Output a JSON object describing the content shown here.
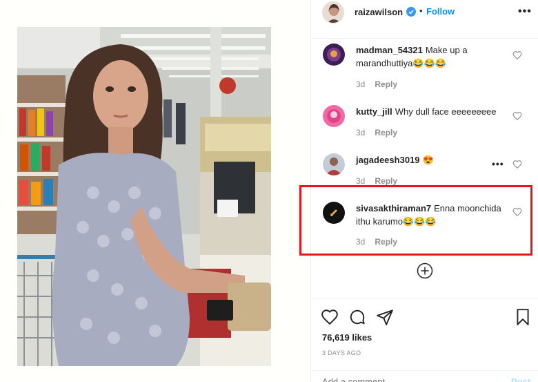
{
  "post": {
    "username": "raizawilson",
    "follow_label": "Follow",
    "dot": "•",
    "more_label": "•••"
  },
  "comments": [
    {
      "user": "madman_54321",
      "text": "Make up a marandhuttiya😂😂😂",
      "time": "3d",
      "reply": "Reply",
      "avatar_color": "#7a3b8f"
    },
    {
      "user": "kutty_jill",
      "text": "Why dull face eeeeeeeee",
      "time": "3d",
      "reply": "Reply",
      "avatar_color": "#e6428c"
    },
    {
      "user": "jagadeesh3019",
      "text": "😍",
      "time": "3d",
      "reply": "Reply",
      "avatar_color": "#8a9a6a"
    },
    {
      "user": "sivasakthiraman7",
      "text": "Enna moonchida ithu karumo😂😂😂",
      "time": "3d",
      "reply": "Reply",
      "avatar_color": "#1a1a1a"
    }
  ],
  "comment_more": "•••",
  "likes": "76,619 likes",
  "posted": "3 DAYS AGO",
  "add_comment": {
    "placeholder": "Add a comment...",
    "post_label": "Post"
  },
  "colors": {
    "accent": "#0095f6",
    "highlight": "#e8141b",
    "post_disabled": "#b2dffc"
  }
}
